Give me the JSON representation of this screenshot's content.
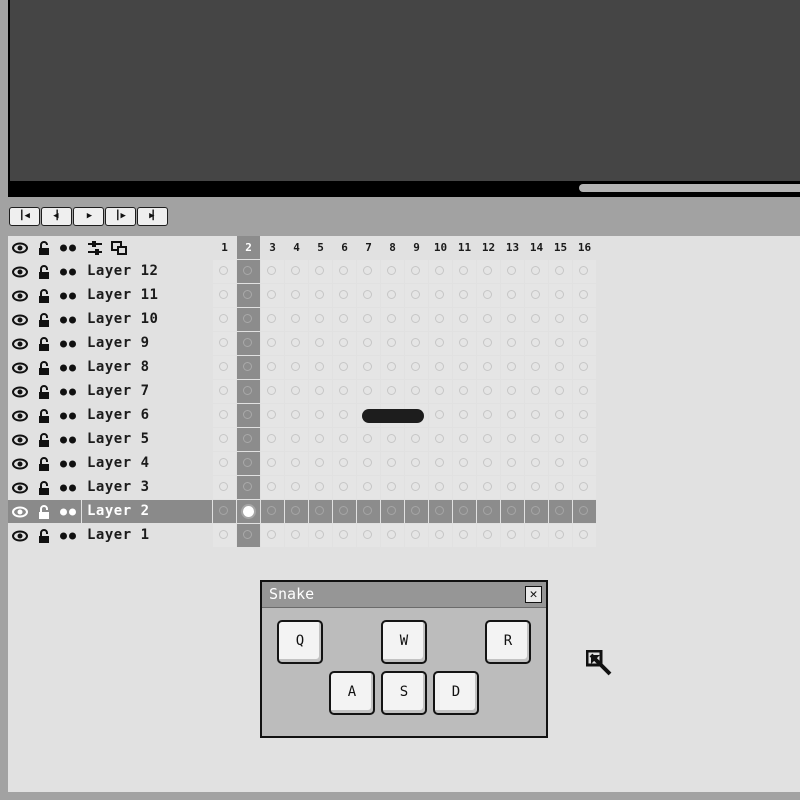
{
  "playback": {
    "buttons": [
      {
        "name": "first-frame-button",
        "glyph": "▎◀"
      },
      {
        "name": "prev-frame-button",
        "glyph": "◀▎"
      },
      {
        "name": "play-button",
        "glyph": "▶"
      },
      {
        "name": "next-frame-button",
        "glyph": "▎▶"
      },
      {
        "name": "last-frame-button",
        "glyph": "▶▎"
      }
    ]
  },
  "timeline": {
    "header_icons": [
      "eye-icon",
      "lock-icon",
      "onion-skin-icon",
      "layer-settings-icon",
      "frame-settings-icon"
    ],
    "frame_numbers": [
      "1",
      "2",
      "3",
      "4",
      "5",
      "6",
      "7",
      "8",
      "9",
      "10",
      "11",
      "12",
      "13",
      "14",
      "15",
      "16"
    ],
    "current_frame": 2,
    "layers": [
      {
        "label": "Layer 12"
      },
      {
        "label": "Layer 11"
      },
      {
        "label": "Layer 10"
      },
      {
        "label": "Layer 9"
      },
      {
        "label": "Layer 8"
      },
      {
        "label": "Layer 7"
      },
      {
        "label": "Layer 6"
      },
      {
        "label": "Layer 5"
      },
      {
        "label": "Layer 4"
      },
      {
        "label": "Layer 3"
      },
      {
        "label": "Layer 2"
      },
      {
        "label": "Layer 1"
      }
    ],
    "selected_layer": "Layer 2",
    "keyframe": {
      "layer": "Layer 2",
      "frame": 2
    },
    "tween": {
      "layer": "Layer 6",
      "from_frame": 7,
      "to_frame": 9
    }
  },
  "snake_panel": {
    "title": "Snake",
    "close_glyph": "✕",
    "keys": {
      "q": "Q",
      "w": "W",
      "r": "R",
      "a": "A",
      "s": "S",
      "d": "D"
    }
  },
  "colors": {
    "canvas": "#454545",
    "timeline_bg": "#e1e1e1",
    "selected_row": "#8a8a8a",
    "keyframe_ring": "#6b2b2b"
  }
}
